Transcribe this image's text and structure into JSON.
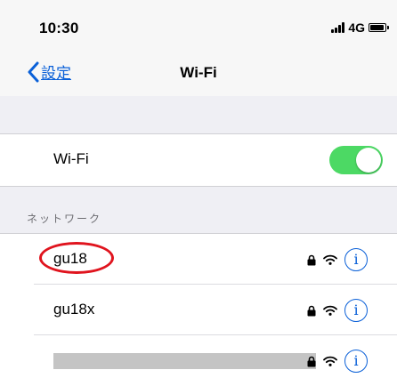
{
  "status_bar": {
    "time": "10:30",
    "network_type": "4G"
  },
  "nav": {
    "back_label": "設定",
    "title": "Wi-Fi"
  },
  "wifi": {
    "label": "Wi-Fi",
    "enabled": true,
    "toggle_color": "#4cd964"
  },
  "networks_section": {
    "header": "ネットワーク",
    "items": [
      {
        "name": "gu18",
        "secured": true,
        "highlighted": true
      },
      {
        "name": "gu18x",
        "secured": true,
        "highlighted": false
      },
      {
        "name": "",
        "secured": true,
        "redacted": true
      }
    ],
    "info_symbol": "i"
  },
  "colors": {
    "accent": "#0a60d8",
    "highlight": "#e0141e"
  }
}
